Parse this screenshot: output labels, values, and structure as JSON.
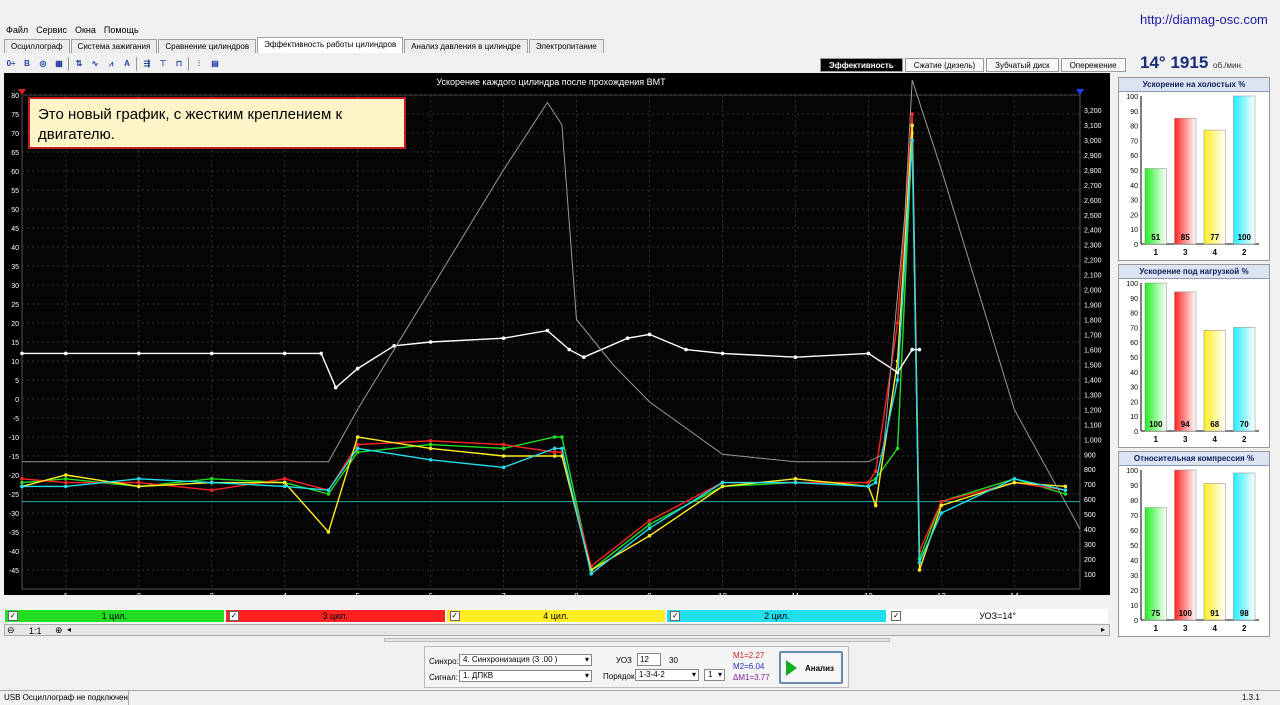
{
  "url": "http://diamag-osc.com",
  "menu": [
    "Файл",
    "Сервис",
    "Окна",
    "Помощь"
  ],
  "tabs": [
    {
      "label": "Осциллограф",
      "active": false
    },
    {
      "label": "Система зажигания",
      "active": false
    },
    {
      "label": "Сравнение цилиндров",
      "active": false
    },
    {
      "label": "Эффективность работы цилиндров",
      "active": true
    },
    {
      "label": "Анализ давления в цилиндре",
      "active": false
    },
    {
      "label": "Электропитание",
      "active": false
    }
  ],
  "toolbar_icons": [
    "scale-icon",
    "bold-icon",
    "zoom-icon",
    "palette-icon",
    "sep",
    "sort-icon",
    "wave-icon",
    "spike-icon",
    "alg-icon",
    "sep",
    "sync-icon",
    "measure-icon",
    "filter-icon",
    "sep",
    "cylinders-icon",
    "table-icon"
  ],
  "mode_tabs": [
    {
      "label": "Эффективность",
      "active": true
    },
    {
      "label": "Сжатие (дизель)",
      "active": false
    },
    {
      "label": "Зубчатый диск",
      "active": false
    },
    {
      "label": "Опережение",
      "active": false
    }
  ],
  "readout": {
    "angle": "14°",
    "rpm": "1915",
    "rpm_unit": "об./мин."
  },
  "chart": {
    "title": "Ускорение каждого цилиндра после прохождения ВМТ",
    "note": "Это новый график, с жестким креплением к двигателю.",
    "background": "#000000"
  },
  "chart_data": {
    "type": "line",
    "title": "Ускорение каждого цилиндра после прохождения ВМТ",
    "x": {
      "min": 0.4,
      "max": 14.9,
      "ticks": [
        1,
        2,
        3,
        4,
        5,
        6,
        7,
        8,
        9,
        10,
        11,
        12,
        13,
        14
      ]
    },
    "y_left": {
      "min": -50,
      "max": 80,
      "ticks": [
        80,
        75,
        70,
        65,
        60,
        55,
        50,
        45,
        40,
        35,
        30,
        25,
        20,
        15,
        10,
        5,
        0,
        -5,
        -10,
        -15,
        -20,
        -25,
        -30,
        -35,
        -40,
        -45
      ]
    },
    "y_right": {
      "min": 0,
      "max": 3300,
      "ticks": [
        100,
        200,
        300,
        400,
        500,
        600,
        700,
        800,
        900,
        1000,
        1100,
        1200,
        1300,
        1400,
        1500,
        1600,
        1700,
        1800,
        1900,
        2000,
        2100,
        2200,
        2300,
        2400,
        2500,
        2600,
        2700,
        2800,
        2900,
        3000,
        3100,
        3200
      ],
      "tick_labels": [
        "100",
        "200",
        "300",
        "400",
        "500",
        "600",
        "700",
        "800",
        "900",
        "1,000",
        "1,100",
        "1,200",
        "1,300",
        "1,400",
        "1,500",
        "1,600",
        "1,700",
        "1,800",
        "1,900",
        "2,000",
        "2,100",
        "2,200",
        "2,300",
        "2,400",
        "2,500",
        "2,600",
        "2,700",
        "2,800",
        "2,900",
        "3,000",
        "3,100",
        "3,200"
      ]
    },
    "baseline_y": -27,
    "series": [
      {
        "name": "1 цил.",
        "color": "#22dd22",
        "axis": "left",
        "x": [
          0.4,
          1,
          2,
          3,
          4,
          4.6,
          5,
          6,
          7,
          7.7,
          7.8,
          8.2,
          9,
          10,
          11,
          12,
          12.1,
          12.4,
          12.6,
          12.7,
          13,
          14,
          14.7
        ],
        "y": [
          -22,
          -21,
          -23,
          -21,
          -22,
          -25,
          -14,
          -12,
          -13,
          -10,
          -10,
          -45,
          -33,
          -23,
          -22,
          -22,
          -21,
          -13,
          70,
          -42,
          -27,
          -21,
          -25
        ]
      },
      {
        "name": "3 цил.",
        "color": "#ff2222",
        "axis": "left",
        "x": [
          0.4,
          1,
          2,
          3,
          4,
          4.6,
          5,
          6,
          7,
          7.7,
          7.8,
          8.2,
          9,
          10,
          11,
          12,
          12.1,
          12.4,
          12.6,
          12.7,
          13,
          14,
          14.7
        ],
        "y": [
          -21,
          -22,
          -22,
          -24,
          -21,
          -24,
          -12,
          -11,
          -12,
          -14,
          -14,
          -44,
          -32,
          -22,
          -22,
          -22,
          -19,
          20,
          75,
          -40,
          -27,
          -22,
          -24
        ]
      },
      {
        "name": "4 цил.",
        "color": "#ffee22",
        "axis": "left",
        "x": [
          0.4,
          1,
          2,
          3,
          4,
          4.6,
          5,
          6,
          7,
          7.7,
          7.8,
          8.2,
          9,
          10,
          11,
          12,
          12.1,
          12.4,
          12.6,
          12.7,
          13,
          14,
          14.7
        ],
        "y": [
          -23,
          -20,
          -23,
          -22,
          -22,
          -35,
          -10,
          -13,
          -15,
          -15,
          -15,
          -45,
          -36,
          -23,
          -21,
          -23,
          -28,
          10,
          72,
          -45,
          -28,
          -22,
          -23
        ]
      },
      {
        "name": "2 цил.",
        "color": "#22ddee",
        "axis": "left",
        "x": [
          0.4,
          1,
          2,
          3,
          4,
          4.6,
          5,
          6,
          7,
          7.7,
          7.8,
          8.2,
          9,
          10,
          11,
          12,
          12.1,
          12.4,
          12.6,
          12.7,
          13,
          14,
          14.7
        ],
        "y": [
          -23,
          -23,
          -21,
          -22,
          -23,
          -24,
          -13,
          -16,
          -18,
          -13,
          -13,
          -46,
          -34,
          -22,
          -22,
          -23,
          -22,
          5,
          68,
          -43,
          -30,
          -21,
          -24
        ]
      },
      {
        "name": "УОЗ=14°",
        "color": "#ffffff",
        "axis": "left",
        "x": [
          0.4,
          1,
          2,
          3,
          4,
          4.5,
          4.7,
          5,
          5.5,
          6,
          7,
          7.6,
          7.9,
          8.1,
          8.7,
          9,
          9.5,
          10,
          11,
          12,
          12.4,
          12.6,
          12.7
        ],
        "y": [
          12,
          12,
          12,
          12,
          12,
          12,
          3,
          8,
          14,
          15,
          16,
          18,
          13,
          11,
          16,
          17,
          13,
          12,
          11,
          12,
          7,
          13,
          13
        ]
      },
      {
        "name": "об./мин.",
        "color": "#999999",
        "axis": "right",
        "x": [
          0.4,
          4,
          4.6,
          5,
          6,
          7,
          7.6,
          7.8,
          8,
          8.5,
          9,
          10,
          11,
          12,
          12.2,
          12.5,
          12.6,
          13,
          14,
          14.9
        ],
        "y": [
          850,
          850,
          850,
          1200,
          2000,
          2800,
          3250,
          3100,
          1800,
          1500,
          1250,
          900,
          850,
          850,
          900,
          2500,
          3400,
          2800,
          1200,
          400
        ]
      }
    ]
  },
  "legend": [
    {
      "label": "1 цил.",
      "bg": "#22dd22",
      "fg": "#000000"
    },
    {
      "label": "3 цил.",
      "bg": "#ff2222",
      "fg": "#000000"
    },
    {
      "label": "4 цил.",
      "bg": "#ffee22",
      "fg": "#000000"
    },
    {
      "label": "2 цил.",
      "bg": "#22ddee",
      "fg": "#000000"
    },
    {
      "label": "УОЗ=14°",
      "bg": "#ffffff",
      "fg": "#000000"
    }
  ],
  "scroll": {
    "zoom": "1:1"
  },
  "side_charts": [
    {
      "title": "Ускорение на холостых %",
      "categories": [
        "1",
        "3",
        "4",
        "2"
      ],
      "values": [
        51,
        85,
        77,
        100
      ],
      "ylim": [
        0,
        100
      ],
      "yticks": [
        0,
        10,
        20,
        30,
        40,
        50,
        60,
        70,
        80,
        90,
        100
      ]
    },
    {
      "title": "Ускорение под нагрузкой %",
      "categories": [
        "1",
        "3",
        "4",
        "2"
      ],
      "values": [
        100,
        94,
        68,
        70
      ],
      "ylim": [
        0,
        100
      ],
      "yticks": [
        0,
        10,
        20,
        30,
        40,
        50,
        60,
        70,
        80,
        90,
        100
      ]
    },
    {
      "title": "Относительная компрессия %",
      "categories": [
        "1",
        "3",
        "4",
        "2"
      ],
      "values": [
        75,
        100,
        91,
        98
      ],
      "ylim": [
        0,
        100
      ],
      "yticks": [
        0,
        10,
        20,
        30,
        40,
        50,
        60,
        70,
        80,
        90,
        100
      ]
    }
  ],
  "bar_colors": [
    "#22ee22",
    "#ff2222",
    "#ffee22",
    "#22eeff"
  ],
  "controls": {
    "sync_label": "Синхро:",
    "sync_value": "4.  Синхронизация (3 .00 )",
    "signal_label": "Сигнал:",
    "signal_value": "1.  ДПКВ",
    "uoz_label": "УОЗ",
    "uoz_value": "12",
    "uoz_extra": "30",
    "order_label": "Порядок",
    "order_value": "1-3-4-2",
    "order_extra": "1",
    "m1": "M1=2.27",
    "m2": "M2=6.04",
    "dm": "ΔM1=3.77",
    "analyze_label": "Анализ"
  },
  "status": {
    "left": "USB Осциллограф не подключен",
    "version": "1.3.1"
  }
}
